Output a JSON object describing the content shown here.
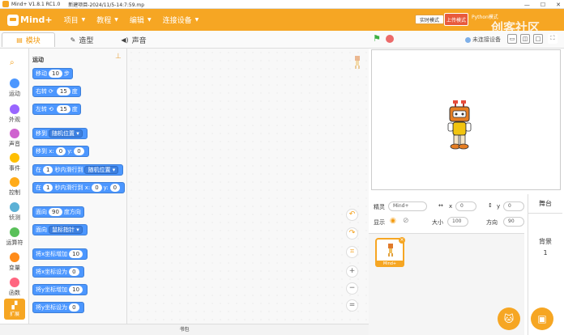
{
  "titlebar": {
    "app": "Mind+ V1.8.1 RC1.0",
    "project": "新建项目-2024/11/5-14:7:59.mp"
  },
  "menubar": {
    "logo_text": "Mind+",
    "menus": [
      "项目",
      "教程",
      "编辑",
      "连接设备"
    ],
    "realtime_mode": "实时模式",
    "upload_mode": "上传模式",
    "python_mode": "Python模式",
    "watermark": "创客社区",
    "accent": "#f6a623"
  },
  "tabs": {
    "blocks": "模块",
    "costumes": "造型",
    "sounds": "声音"
  },
  "stage_toolbar": {
    "connection": "未连接设备"
  },
  "categories": [
    {
      "label": "运动",
      "color": "#4c97ff"
    },
    {
      "label": "外观",
      "color": "#9966ff"
    },
    {
      "label": "声音",
      "color": "#cf63cf"
    },
    {
      "label": "事件",
      "color": "#ffbf00"
    },
    {
      "label": "控制",
      "color": "#ffab19"
    },
    {
      "label": "侦测",
      "color": "#5cb1d6"
    },
    {
      "label": "运算符",
      "color": "#59c059"
    },
    {
      "label": "变量",
      "color": "#ff8c1a"
    },
    {
      "label": "函数",
      "color": "#ff6680"
    }
  ],
  "extension_label": "扩展",
  "palette": {
    "title": "运动",
    "blocks": [
      {
        "a": "移动",
        "n1": "10",
        "b": "步"
      },
      {
        "a": "右转",
        "icon": "⟳",
        "n1": "15",
        "b": "度"
      },
      {
        "a": "左转",
        "icon": "⟲",
        "n1": "15",
        "b": "度"
      },
      {
        "a": "移到",
        "dd": "随机位置"
      },
      {
        "a": "移到 x:",
        "n1": "0",
        "b": "y:",
        "n2": "0"
      },
      {
        "a": "在",
        "n1": "1",
        "b": "秒内滑行到",
        "dd": "随机位置"
      },
      {
        "a": "在",
        "n1": "1",
        "b": "秒内滑行到 x:",
        "n2": "0",
        "c": "y:",
        "n3": "0"
      },
      {
        "a": "面向",
        "n1": "90",
        "b": "度方向"
      },
      {
        "a": "面向",
        "dd": "鼠标指针"
      },
      {
        "a": "将x坐标增加",
        "n1": "10"
      },
      {
        "a": "将x坐标设为",
        "n1": "0"
      },
      {
        "a": "将y坐标增加",
        "n1": "10"
      },
      {
        "a": "将y坐标设为",
        "n1": "0"
      }
    ]
  },
  "bookbar": "书包",
  "sprite_info": {
    "sprite_label": "精灵",
    "sprite_name": "Mind+",
    "x_label": "x",
    "x_value": "0",
    "y_label": "y",
    "y_value": "0",
    "show_label": "显示",
    "size_label": "大小",
    "size_value": "100",
    "direction_label": "方向",
    "direction_value": "90"
  },
  "sprite_list": [
    {
      "name": "Mind+"
    }
  ],
  "stage_pane": {
    "title": "舞台",
    "backdrop_label": "背景",
    "backdrop_count": "1"
  }
}
